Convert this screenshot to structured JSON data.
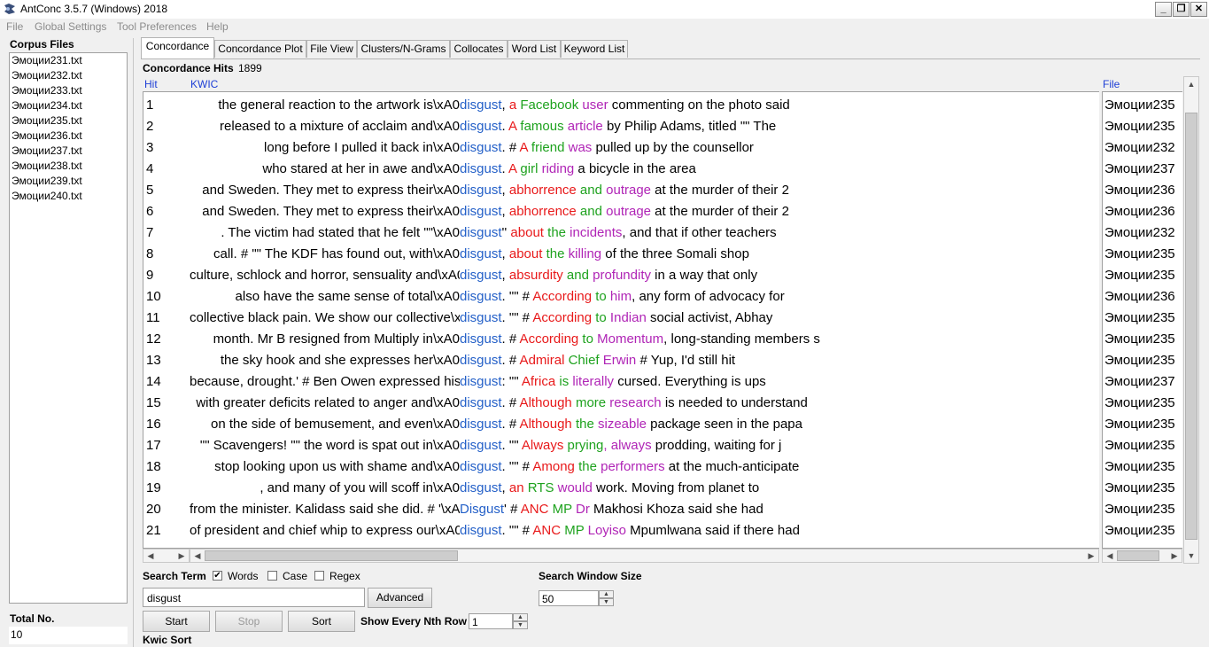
{
  "window": {
    "title": "AntConc 3.5.7 (Windows) 2018"
  },
  "menu": [
    "File",
    "Global Settings",
    "Tool Preferences",
    "Help"
  ],
  "corpus": {
    "label": "Corpus Files",
    "files": [
      "Эмоции231.txt",
      "Эмоции232.txt",
      "Эмоции233.txt",
      "Эмоции234.txt",
      "Эмоции235.txt",
      "Эмоции236.txt",
      "Эмоции237.txt",
      "Эмоции238.txt",
      "Эмоции239.txt",
      "Эмоции240.txt"
    ],
    "total_label": "Total No.",
    "total_value": "10"
  },
  "tabs": [
    "Concordance",
    "Concordance Plot",
    "File View",
    "Clusters/N-Grams",
    "Collocates",
    "Word List",
    "Keyword List"
  ],
  "hits": {
    "label": "Concordance Hits",
    "count": "1899"
  },
  "columns": {
    "hit": "Hit",
    "kwic": "KWIC",
    "file": "File"
  },
  "rows": [
    {
      "hit": "1",
      "left": "the general reaction to the artwork is\\xA0",
      "kw": "disgust",
      "right": [
        [
          ",",
          ""
        ],
        [
          " a",
          "r"
        ],
        [
          " Facebook",
          "g"
        ],
        [
          " user",
          "p"
        ],
        [
          " commenting on the photo said",
          ""
        ]
      ],
      "file": "Эмоции235"
    },
    {
      "hit": "2",
      "left": "released to a mixture of acclaim and\\xA0",
      "kw": "disgust",
      "right": [
        [
          ".",
          ""
        ],
        [
          " A",
          "r"
        ],
        [
          " famous",
          "g"
        ],
        [
          " article",
          "p"
        ],
        [
          " by Philip Adams, titled \"\" The",
          ""
        ]
      ],
      "file": "Эмоции235"
    },
    {
      "hit": "3",
      "left": "long before I pulled it back in\\xA0",
      "kw": "disgust",
      "right": [
        [
          ". #",
          ""
        ],
        [
          " A",
          "r"
        ],
        [
          " friend",
          "g"
        ],
        [
          " was",
          "p"
        ],
        [
          " pulled up by the counsellor",
          ""
        ]
      ],
      "file": "Эмоции232"
    },
    {
      "hit": "4",
      "left": "who stared at her in awe and\\xA0",
      "kw": "disgust",
      "right": [
        [
          ".",
          ""
        ],
        [
          " A",
          "r"
        ],
        [
          " girl",
          "g"
        ],
        [
          " riding",
          "p"
        ],
        [
          " a bicycle in the area",
          ""
        ]
      ],
      "file": "Эмоции237"
    },
    {
      "hit": "5",
      "left": "and Sweden. They met to express their\\xA0",
      "kw": "disgust",
      "right": [
        [
          ",",
          ""
        ],
        [
          " abhorrence",
          "r"
        ],
        [
          " and",
          "g"
        ],
        [
          " outrage",
          "p"
        ],
        [
          " at the murder of their 2",
          ""
        ]
      ],
      "file": "Эмоции236"
    },
    {
      "hit": "6",
      "left": "and Sweden. They met to express their\\xA0",
      "kw": "disgust",
      "right": [
        [
          ",",
          ""
        ],
        [
          " abhorrence",
          "r"
        ],
        [
          " and",
          "g"
        ],
        [
          " outrage",
          "p"
        ],
        [
          " at the murder of their 2",
          ""
        ]
      ],
      "file": "Эмоции236"
    },
    {
      "hit": "7",
      "left": ". The victim had stated that he felt \"\"\\xA0",
      "kw": "disgust",
      "right": [
        [
          "''",
          ""
        ],
        [
          " about",
          "r"
        ],
        [
          " the",
          "g"
        ],
        [
          " incidents",
          "p"
        ],
        [
          ", and that if other teachers",
          ""
        ]
      ],
      "file": "Эмоции232"
    },
    {
      "hit": "8",
      "left": "call. # \"\" The KDF has found out, with\\xA0",
      "kw": "disgust",
      "right": [
        [
          ",",
          ""
        ],
        [
          " about",
          "r"
        ],
        [
          " the",
          "g"
        ],
        [
          " killing",
          "p"
        ],
        [
          " of the three Somali shop",
          ""
        ]
      ],
      "file": "Эмоции235"
    },
    {
      "hit": "9",
      "left": "culture, schlock and horror, sensuality and\\xA0",
      "kw": "disgust",
      "right": [
        [
          ",",
          ""
        ],
        [
          " absurdity",
          "r"
        ],
        [
          " and",
          "g"
        ],
        [
          " profundity",
          "p"
        ],
        [
          " in a way that only",
          ""
        ]
      ],
      "file": "Эмоции235"
    },
    {
      "hit": "10",
      "left": "also have the same sense of total\\xA0",
      "kw": "disgust",
      "right": [
        [
          ". \"\" #",
          ""
        ],
        [
          " According",
          "r"
        ],
        [
          " to",
          "g"
        ],
        [
          " him",
          "p"
        ],
        [
          ", any form of advocacy for",
          ""
        ]
      ],
      "file": "Эмоции236"
    },
    {
      "hit": "11",
      "left": "collective black pain. We show our collective\\xA0",
      "kw": "disgust",
      "right": [
        [
          ". \"\" #",
          ""
        ],
        [
          " According",
          "r"
        ],
        [
          " to",
          "g"
        ],
        [
          " Indian",
          "p"
        ],
        [
          " social activist, Abhay",
          ""
        ]
      ],
      "file": "Эмоции235"
    },
    {
      "hit": "12",
      "left": "month. Mr B resigned from Multiply in\\xA0",
      "kw": "disgust",
      "right": [
        [
          ". #",
          ""
        ],
        [
          " According",
          "r"
        ],
        [
          " to",
          "g"
        ],
        [
          " Momentum",
          "p"
        ],
        [
          ", long-standing members s",
          ""
        ]
      ],
      "file": "Эмоции235"
    },
    {
      "hit": "13",
      "left": "the sky hook and she expresses her\\xA0",
      "kw": "disgust",
      "right": [
        [
          ". #",
          ""
        ],
        [
          " Admiral",
          "r"
        ],
        [
          " Chief",
          "g"
        ],
        [
          " Erwin",
          "p"
        ],
        [
          " # Yup, I'd still hit",
          ""
        ]
      ],
      "file": "Эмоции235"
    },
    {
      "hit": "14",
      "left": "because, drought.' # Ben Owen expressed his\\xA0",
      "kw": "disgust",
      "right": [
        [
          ": \"\"",
          ""
        ],
        [
          " Africa",
          "r"
        ],
        [
          " is",
          "g"
        ],
        [
          " literally",
          "p"
        ],
        [
          " cursed. Everything is ups",
          ""
        ]
      ],
      "file": "Эмоции237"
    },
    {
      "hit": "15",
      "left": "with greater deficits related to anger and\\xA0",
      "kw": "disgust",
      "right": [
        [
          ". #",
          ""
        ],
        [
          " Although",
          "r"
        ],
        [
          " more",
          "g"
        ],
        [
          " research",
          "p"
        ],
        [
          " is needed to understand",
          ""
        ]
      ],
      "file": "Эмоции235"
    },
    {
      "hit": "16",
      "left": "on the side of bemusement, and even\\xA0",
      "kw": "disgust",
      "right": [
        [
          ". #",
          ""
        ],
        [
          " Although",
          "r"
        ],
        [
          " the",
          "g"
        ],
        [
          " sizeable",
          "p"
        ],
        [
          " package seen in the papa",
          ""
        ]
      ],
      "file": "Эмоции235"
    },
    {
      "hit": "17",
      "left": "\"\" Scavengers! \"\" the word is spat out in\\xA0",
      "kw": "disgust",
      "right": [
        [
          ". \"\"",
          ""
        ],
        [
          " Always",
          "r"
        ],
        [
          " prying",
          "g"
        ],
        [
          ", always",
          "p"
        ],
        [
          " prodding, waiting for j",
          ""
        ]
      ],
      "file": "Эмоции235"
    },
    {
      "hit": "18",
      "left": "stop looking upon us with shame and\\xA0",
      "kw": "disgust",
      "right": [
        [
          ". \"\" #",
          ""
        ],
        [
          " Among",
          "r"
        ],
        [
          " the",
          "g"
        ],
        [
          " performers",
          "p"
        ],
        [
          " at the much-anticipate",
          ""
        ]
      ],
      "file": "Эмоции235"
    },
    {
      "hit": "19",
      "left": ", and many of you will scoff in\\xA0",
      "kw": "disgust",
      "right": [
        [
          ",",
          ""
        ],
        [
          " an",
          "r"
        ],
        [
          " RTS",
          "g"
        ],
        [
          " would",
          "p"
        ],
        [
          " work. Moving from planet to",
          ""
        ]
      ],
      "file": "Эмоции235"
    },
    {
      "hit": "20",
      "left": "from the minister. Kalidass said she did. # '\\xA0",
      "kw": "Disgust",
      "right": [
        [
          "' #",
          ""
        ],
        [
          " ANC",
          "r"
        ],
        [
          " MP",
          "g"
        ],
        [
          " Dr",
          "p"
        ],
        [
          " Makhosi Khoza said she had",
          ""
        ]
      ],
      "file": "Эмоции235"
    },
    {
      "hit": "21",
      "left": "of president and chief whip to express our\\xA0",
      "kw": "disgust",
      "right": [
        [
          ". \"\" #",
          ""
        ],
        [
          " ANC",
          "r"
        ],
        [
          " MP",
          "g"
        ],
        [
          " Loyiso",
          "p"
        ],
        [
          " Mpumlwana said if there had",
          ""
        ]
      ],
      "file": "Эмоции235"
    }
  ],
  "colors": {
    "red": "#e8191a",
    "green": "#1ea21e",
    "purple": "#b025b6",
    "keyword": "#2460c8",
    "header": "#1f40d6"
  },
  "search": {
    "term_label": "Search Term",
    "words_label": "Words",
    "words_checked": true,
    "case_label": "Case",
    "case_checked": false,
    "regex_label": "Regex",
    "regex_checked": false,
    "value": "disgust",
    "advanced_label": "Advanced",
    "window_label": "Search Window Size",
    "window_value": "50",
    "start_label": "Start",
    "stop_label": "Stop",
    "sort_label": "Sort",
    "nth_label": "Show Every Nth Row",
    "nth_value": "1",
    "kwic_sort_label": "Kwic Sort"
  }
}
